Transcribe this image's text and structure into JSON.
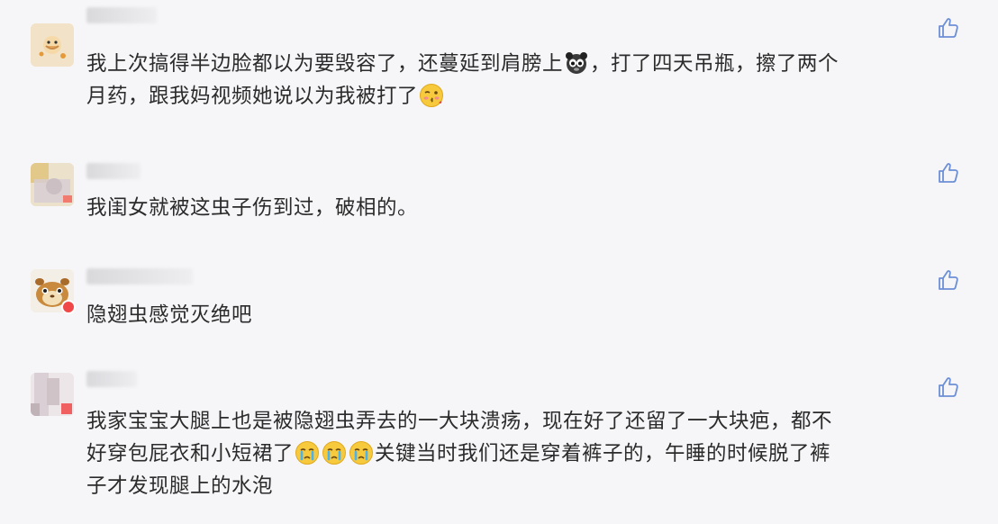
{
  "comments": [
    {
      "text_line1_a": "我上次搞得半边脸都以为要毁容了，还蔓延到肩膀上",
      "text_line1_b": "，打了四天吊瓶，擦了两个",
      "text_line2": "月药，跟我妈视频她说以为我被打了",
      "emoji": [
        "panda-face-icon",
        "kiss-face-icon"
      ]
    },
    {
      "text": "我闺女就被这虫子伤到过，破相的。"
    },
    {
      "text": "隐翅虫感觉灭绝吧"
    },
    {
      "text_line1": "我家宝宝大腿上也是被隐翅虫弄去的一大块溃疡，现在好了还留了一大块疤，都不",
      "text_line2_a": "好穿包屁衣和小短裙了",
      "text_line2_b": "关键当时我们还是穿着裤子的，午睡的时候脱了裤",
      "text_line3": "子才发现腿上的水泡",
      "emoji": [
        "crying-face-icon",
        "crying-face-icon",
        "crying-face-icon"
      ]
    }
  ],
  "icons": {
    "like": "thumbs-up-icon"
  },
  "colors": {
    "background": "#f6f6f8",
    "text": "#2b2b2b",
    "like_icon": "#6d8fd6",
    "badge": "#f04848"
  }
}
